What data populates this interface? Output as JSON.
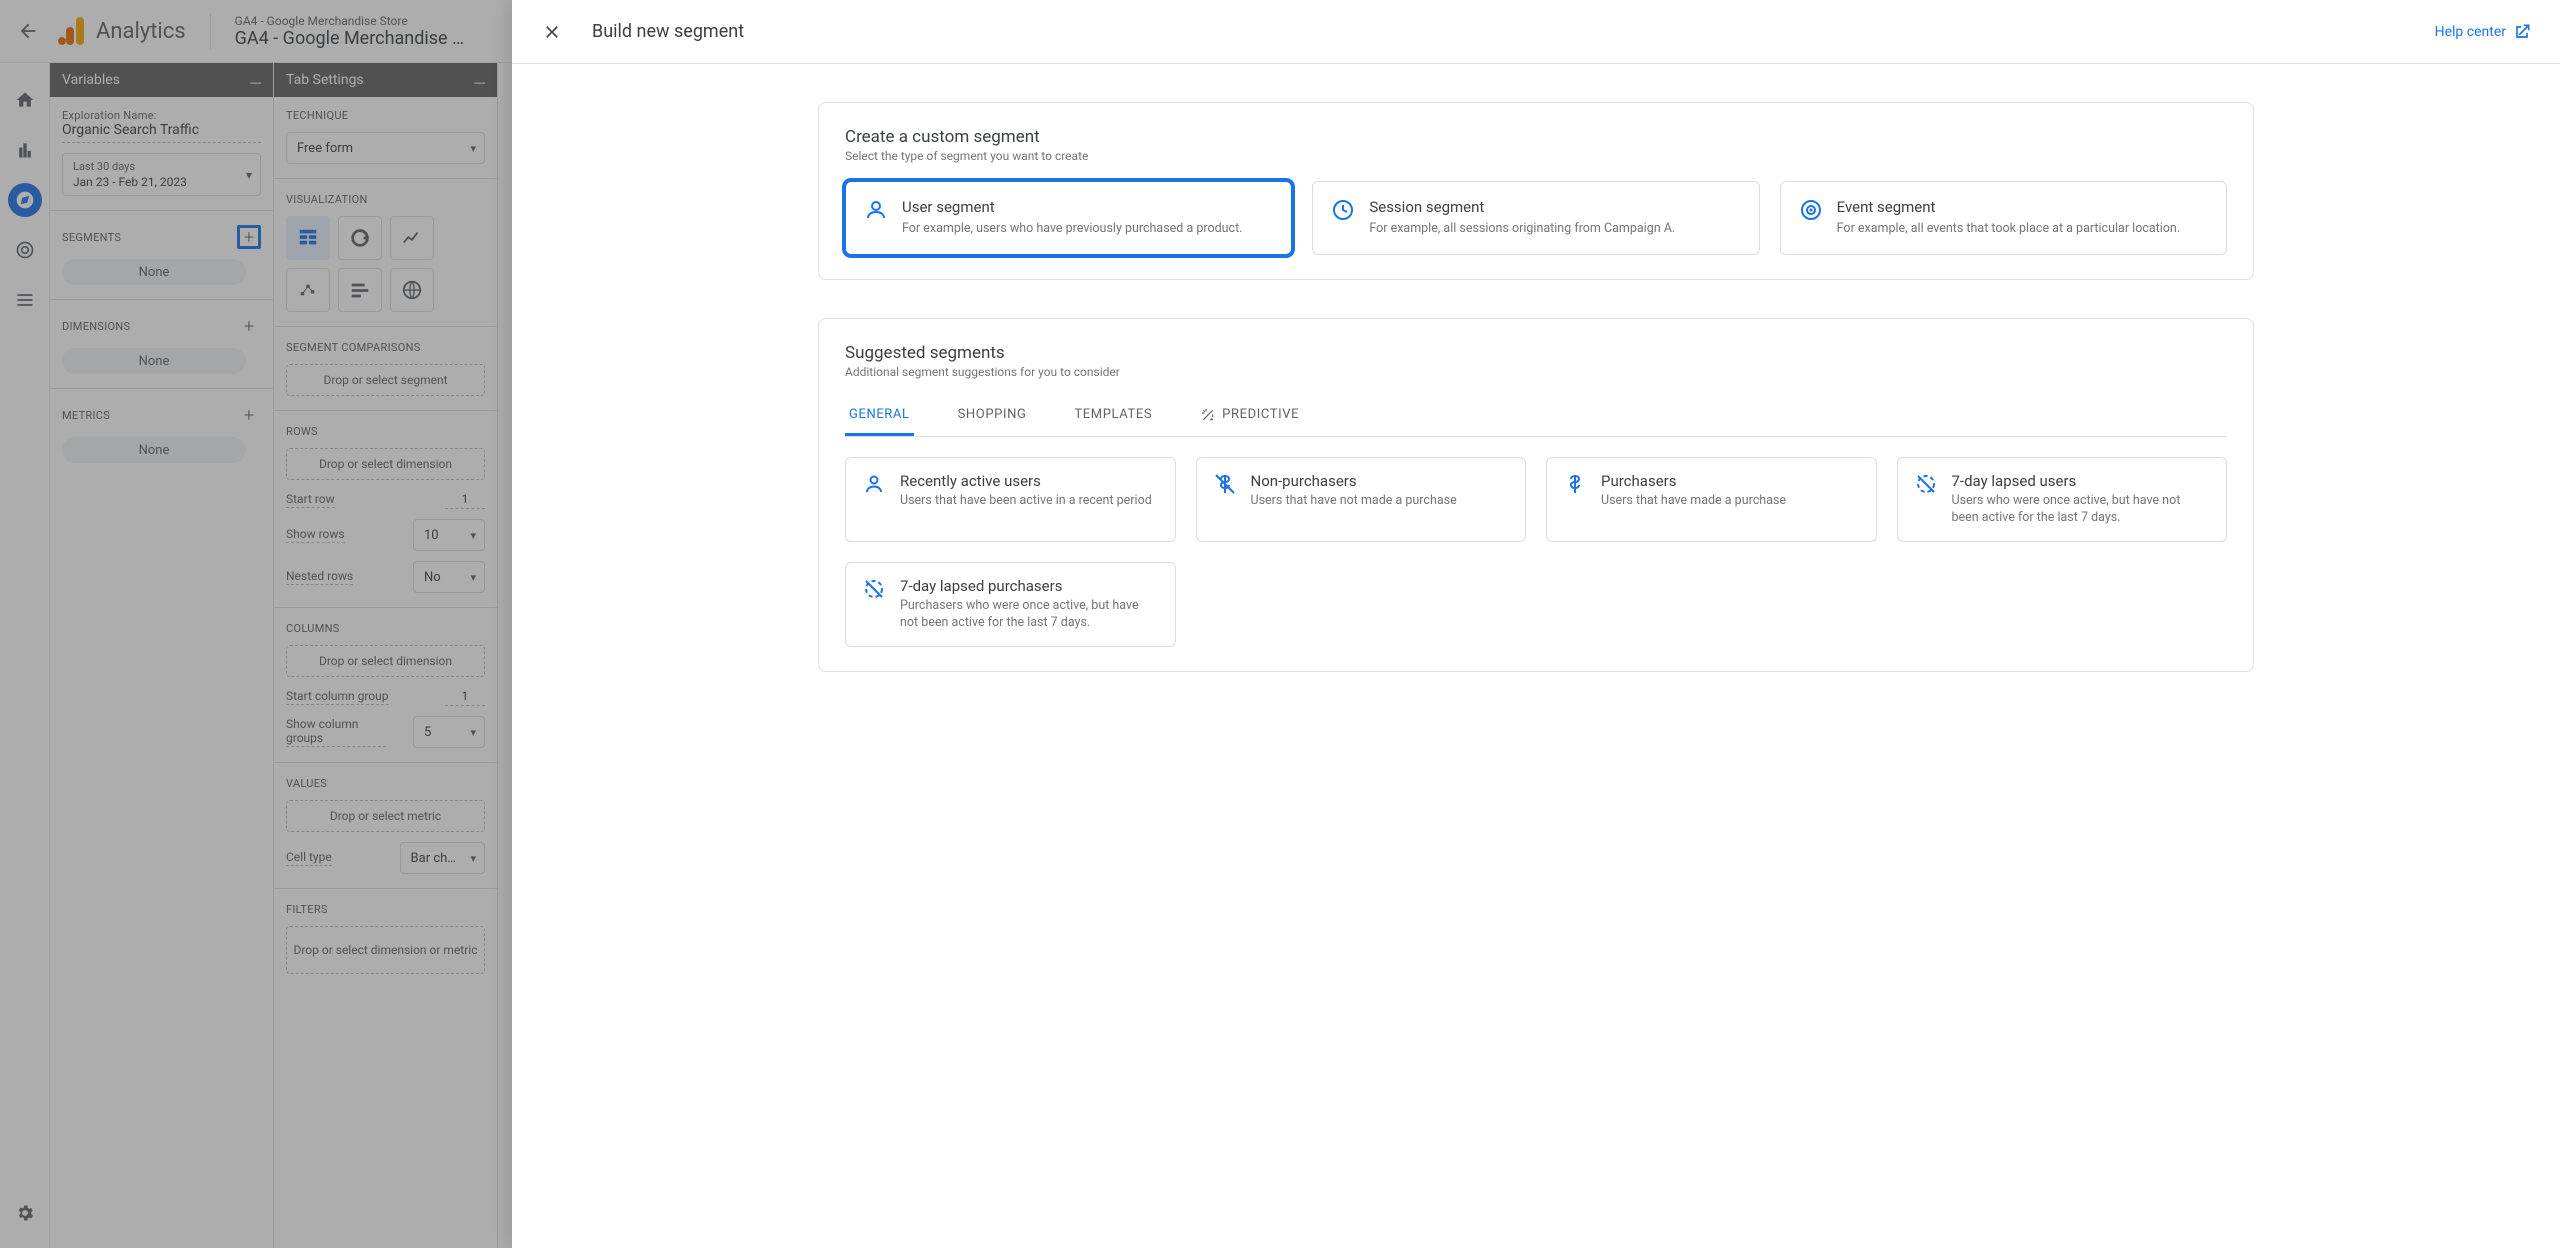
{
  "header": {
    "brand": "Analytics",
    "project_parent": "GA4 - Google Merchandise Store",
    "project_name": "GA4 - Google Merchandise …"
  },
  "variables": {
    "heading": "Variables",
    "exploration_name_label": "Exploration Name:",
    "exploration_name": "Organic Search Traffic",
    "date_preset": "Last 30 days",
    "date_range": "Jan 23 - Feb 21, 2023",
    "sections": {
      "segments": "SEGMENTS",
      "dimensions": "DIMENSIONS",
      "metrics": "METRICS"
    },
    "none": "None"
  },
  "settings": {
    "heading": "Tab Settings",
    "technique_label": "TECHNIQUE",
    "technique_value": "Free form",
    "visualization_label": "VISUALIZATION",
    "segment_comparisons_label": "SEGMENT COMPARISONS",
    "drop_segment": "Drop or select segment",
    "rows_label": "ROWS",
    "drop_dimension": "Drop or select dimension",
    "start_row_label": "Start row",
    "start_row_value": "1",
    "show_rows_label": "Show rows",
    "show_rows_value": "10",
    "nested_rows_label": "Nested rows",
    "nested_rows_value": "No",
    "columns_label": "COLUMNS",
    "start_col_group_label": "Start column group",
    "start_col_group_value": "1",
    "show_col_groups_label": "Show column groups",
    "show_col_groups_value": "5",
    "values_label": "VALUES",
    "drop_metric": "Drop or select metric",
    "cell_type_label": "Cell type",
    "cell_type_value": "Bar ch…",
    "filters_label": "FILTERS",
    "drop_filter": "Drop or select dimension or metric"
  },
  "modal": {
    "title": "Build new segment",
    "help": "Help center",
    "custom": {
      "title": "Create a custom segment",
      "subtitle": "Select the type of segment you want to create",
      "options": [
        {
          "icon": "user",
          "title": "User segment",
          "desc": "For example, users who have previously purchased a product."
        },
        {
          "icon": "session",
          "title": "Session segment",
          "desc": "For example, all sessions originating from Campaign A."
        },
        {
          "icon": "event",
          "title": "Event segment",
          "desc": "For example, all events that took place at a particular location."
        }
      ]
    },
    "suggested": {
      "title": "Suggested segments",
      "subtitle": "Additional segment suggestions for you to consider",
      "tabs": [
        "GENERAL",
        "SHOPPING",
        "TEMPLATES",
        "PREDICTIVE"
      ],
      "items": [
        {
          "icon": "activity",
          "title": "Recently active users",
          "desc": "Users that have been active in a recent period"
        },
        {
          "icon": "no-dollar",
          "title": "Non-purchasers",
          "desc": "Users that have not made a purchase"
        },
        {
          "icon": "dollar",
          "title": "Purchasers",
          "desc": "Users that have made a purchase"
        },
        {
          "icon": "lapsed",
          "title": "7-day lapsed users",
          "desc": "Users who were once active, but have not been active for the last 7 days."
        },
        {
          "icon": "lapsed",
          "title": "7-day lapsed purchasers",
          "desc": "Purchasers who were once active, but have not been active for the last 7 days."
        }
      ]
    }
  }
}
